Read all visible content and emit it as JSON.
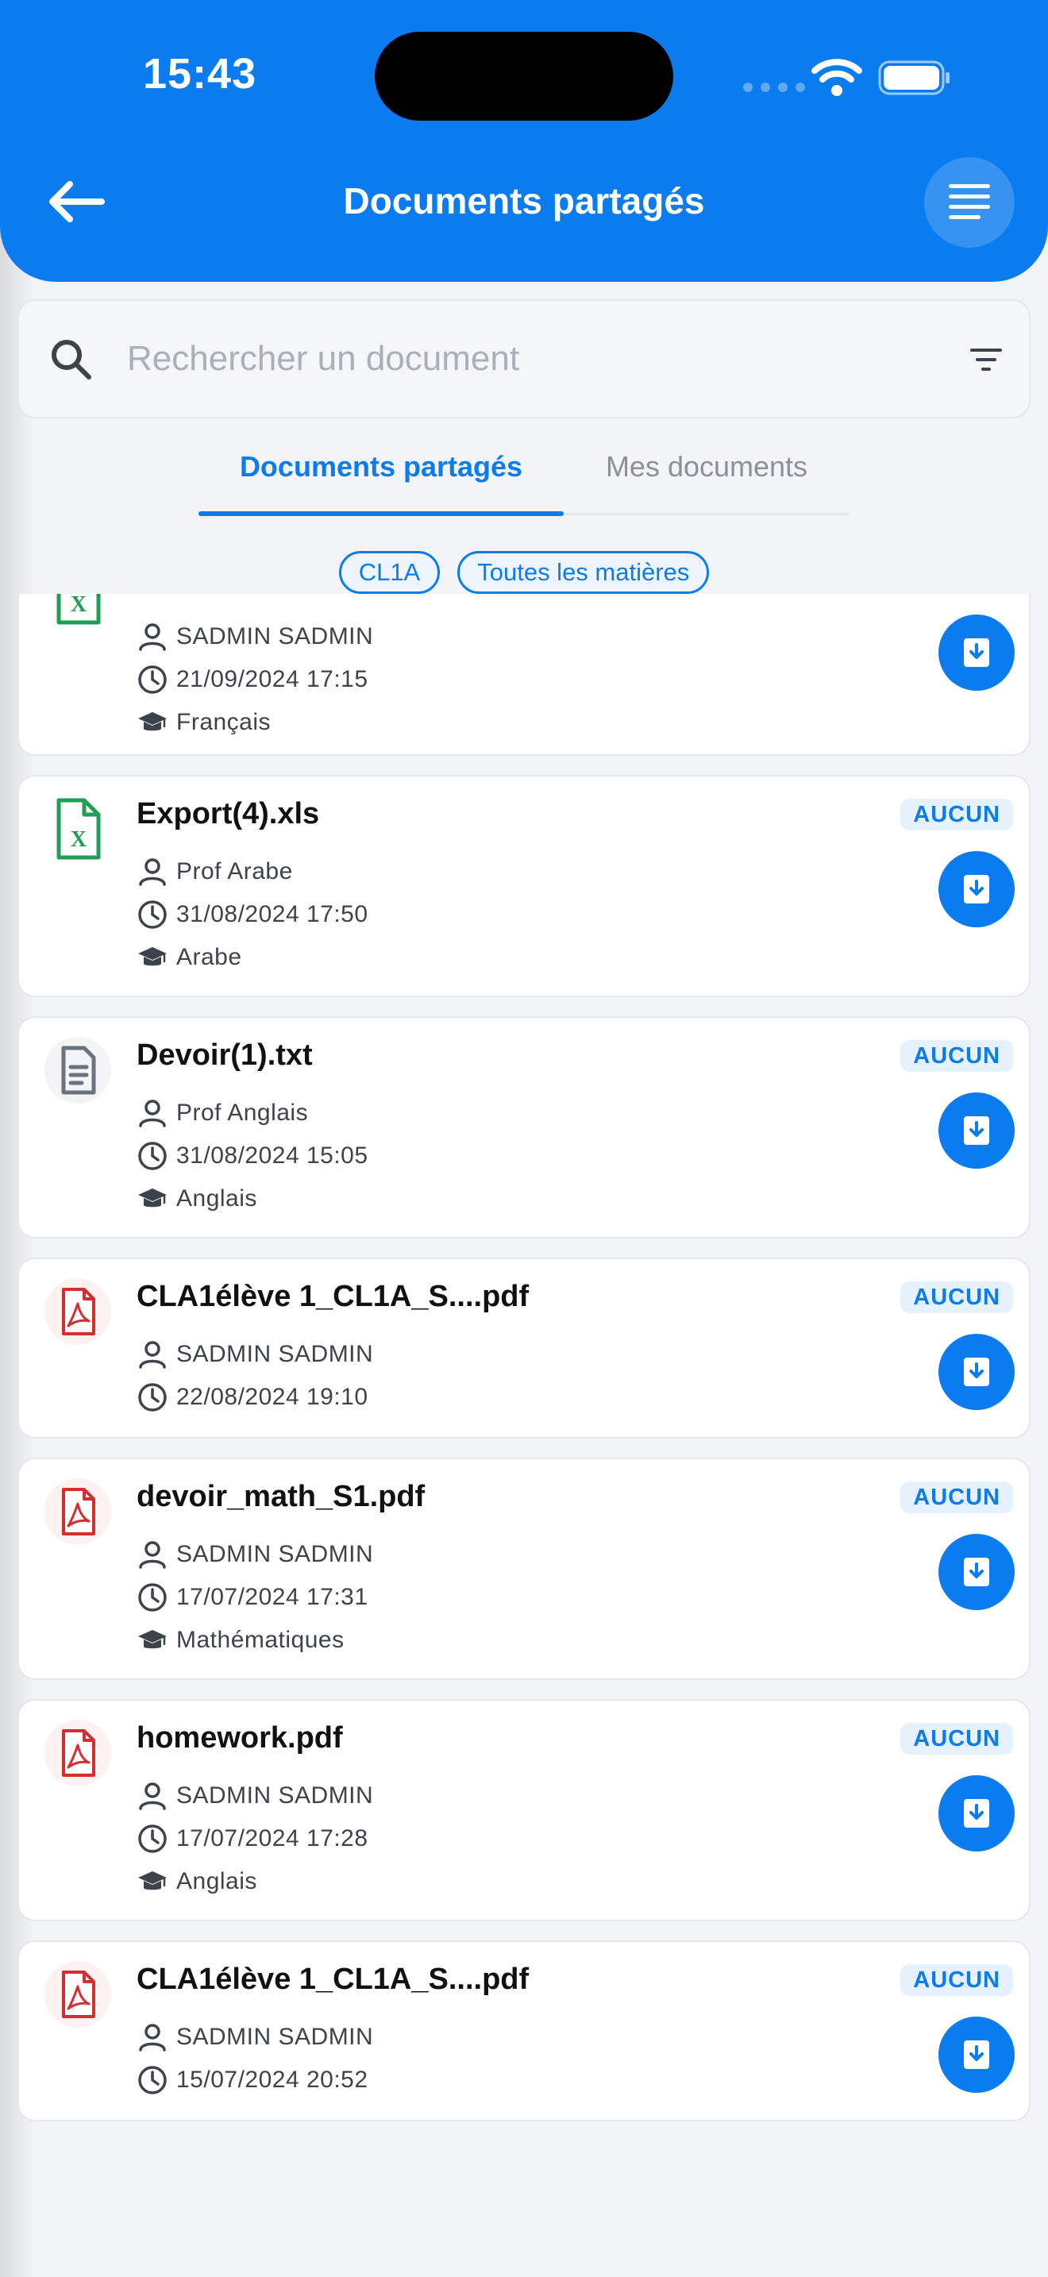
{
  "status_bar": {
    "time": "15:43"
  },
  "header": {
    "title": "Documents partagés"
  },
  "search": {
    "placeholder": "Rechercher un document"
  },
  "tabs": [
    {
      "label": "Documents partagés",
      "active": true
    },
    {
      "label": "Mes documents",
      "active": false
    }
  ],
  "filters": {
    "class_chip": "CL1A",
    "subject_chip": "Toutes les matières"
  },
  "documents": [
    {
      "name": "",
      "type": "xls",
      "badge": "",
      "author": "SADMIN SADMIN",
      "date": "21/09/2024 17:15",
      "subject": "Français"
    },
    {
      "name": "Export(4).xls",
      "type": "xls",
      "badge": "AUCUN",
      "author": "Prof Arabe",
      "date": "31/08/2024 17:50",
      "subject": "Arabe"
    },
    {
      "name": "Devoir(1).txt",
      "type": "txt",
      "badge": "AUCUN",
      "author": "Prof Anglais",
      "date": "31/08/2024 15:05",
      "subject": "Anglais"
    },
    {
      "name": "CLA1élève 1_CL1A_S....pdf",
      "type": "pdf",
      "badge": "AUCUN",
      "author": "SADMIN SADMIN",
      "date": "22/08/2024 19:10",
      "subject": ""
    },
    {
      "name": "devoir_math_S1.pdf",
      "type": "pdf",
      "badge": "AUCUN",
      "author": "SADMIN SADMIN",
      "date": "17/07/2024 17:31",
      "subject": "Mathématiques"
    },
    {
      "name": "homework.pdf",
      "type": "pdf",
      "badge": "AUCUN",
      "author": "SADMIN SADMIN",
      "date": "17/07/2024 17:28",
      "subject": "Anglais"
    },
    {
      "name": "CLA1élève 1_CL1A_S....pdf",
      "type": "pdf",
      "badge": "AUCUN",
      "author": "SADMIN SADMIN",
      "date": "15/07/2024 20:52",
      "subject": ""
    }
  ],
  "colors": {
    "primary": "#0a7cf0",
    "excel": "#1f9d55",
    "pdf": "#d32f2f",
    "txt": "#6b7280"
  },
  "icons": [
    "back-arrow-icon",
    "menu-icon",
    "search-icon",
    "filter-icon",
    "user-icon",
    "clock-icon",
    "graduation-cap-icon",
    "download-icon",
    "excel-file-icon",
    "text-file-icon",
    "pdf-file-icon"
  ]
}
